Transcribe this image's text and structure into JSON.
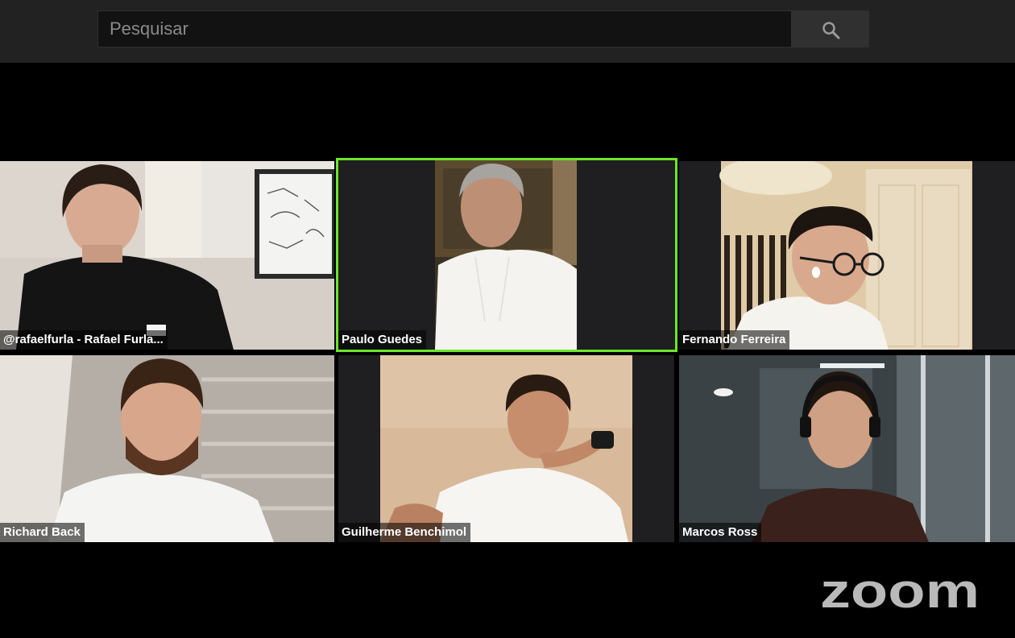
{
  "search": {
    "placeholder": "Pesquisar",
    "button_icon": "search-icon"
  },
  "participants": [
    {
      "name": "@rafaelfurla - Rafael Furla..."
    },
    {
      "name": "Paulo Guedes",
      "active_speaker": true
    },
    {
      "name": "Fernando Ferreira"
    },
    {
      "name": "Richard Back"
    },
    {
      "name": "Guilherme Benchimol"
    },
    {
      "name": "Marcos Ross"
    }
  ],
  "branding": {
    "logo_text": "zoom"
  },
  "colors": {
    "active_speaker_border": "#6de629",
    "background": "#000000",
    "topbar": "#222222"
  }
}
